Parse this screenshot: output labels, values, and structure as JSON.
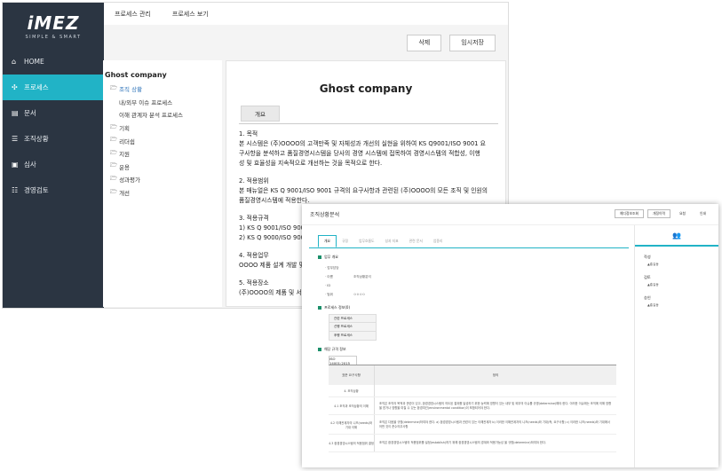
{
  "brand": {
    "logo": "iMEZ",
    "tagline": "SIMPLE & SMART"
  },
  "sidebar": {
    "items": [
      {
        "icon": "home-icon",
        "glyph": "⌂",
        "label": "HOME"
      },
      {
        "icon": "gears-icon",
        "glyph": "✣",
        "label": "프로세스"
      },
      {
        "icon": "document-icon",
        "glyph": "▤",
        "label": "문서"
      },
      {
        "icon": "list-icon",
        "glyph": "☰",
        "label": "조직상황"
      },
      {
        "icon": "audit-icon",
        "glyph": "▣",
        "label": "심사"
      },
      {
        "icon": "review-icon",
        "glyph": "☷",
        "label": "경영검토"
      }
    ]
  },
  "topbar": {
    "tabs": [
      "프로세스 관리",
      "프로세스 보기"
    ]
  },
  "toolbar": {
    "delete_label": "삭제",
    "save_temp_label": "임시저장"
  },
  "tree": {
    "root": "Ghost company",
    "items": [
      {
        "label": "조직 상황",
        "folder": true
      },
      {
        "label": "내/외부 이슈 프로세스",
        "folder": false
      },
      {
        "label": "이해 관계자 분석 프로세스",
        "folder": false
      },
      {
        "label": "기획",
        "folder": true
      },
      {
        "label": "리더쉽",
        "folder": true
      },
      {
        "label": "지원",
        "folder": true
      },
      {
        "label": "운용",
        "folder": true
      },
      {
        "label": "성과평가",
        "folder": true
      },
      {
        "label": "개선",
        "folder": true
      }
    ]
  },
  "document": {
    "title": "Ghost company",
    "tab": "개요",
    "sections": [
      {
        "heading": "1. 목적",
        "lines": [
          "본 시스템은 (주)OOOO의 고객만족 및 자체성과 개선의 실현을 위하여 KS Q9001/ISO 9001 요",
          "구사항을 분석하고 품질경영시스템을 당사의 경영 시스템에 접목하여 경영시스템의 적합성, 이행",
          "성 및 효율성을 지속적으로 개선하는 것을 목적으로 한다."
        ]
      },
      {
        "heading": "2. 적용범위",
        "lines": [
          "본 매뉴얼은 KS Q 9001/ISO 9001 규격의 요구사항과 관련된 (주)OOOO의 모든 조직 및 인원의",
          "품질경영시스템에 적용한다."
        ]
      },
      {
        "heading": "3. 적용규격",
        "lines": [
          "1) KS Q 9001/ISO 9000",
          "2) KS Q 9000/ISO 9000"
        ]
      },
      {
        "heading": "4. 적용업무",
        "lines": [
          "OOOO 제품 설계 개발 및"
        ]
      },
      {
        "heading": "5. 적용장소",
        "lines": [
          "(주)OOOO의 제품 및 서"
        ]
      }
    ]
  },
  "overlay": {
    "title": "조직상황분석",
    "buttons": [
      "예디정보조회",
      "개정이력",
      "요청",
      "인쇄"
    ],
    "tabs": [
      "개요",
      "규정",
      "업무흐름도",
      "성과 지표",
      "관련 문서",
      "업종리"
    ],
    "info_head": "업무 개요",
    "info_rows": [
      {
        "k": "· 업무담당",
        "v": ""
      },
      {
        "k": "· 이름",
        "v": "조직상황분석"
      },
      {
        "k": "· ID",
        "v": ""
      },
      {
        "k": "· 범위",
        "v": "ㅇㅇㅇㅇ"
      }
    ],
    "proc_head": "프로세스 정보(0)",
    "procs": [
      "관련 프로세스",
      "선행 프로세스",
      "후행 프로세스"
    ],
    "std_head": "해당 규격 정보",
    "std_tab": "ISO 14001:2015",
    "std_cols": [
      "표준 요구사항",
      "정의"
    ],
    "std_rows": [
      {
        "c1": "4. 조직상황",
        "c2": ""
      },
      {
        "c1": "4.1 조직과 조직상황의 이해",
        "c2": "조직은 조직의 목적과 관련이 있고, 환경경영시스템의 의도된 결과를 달성하기 위한 능력에 영향이 있는 내부 및 외부의 이슈를 규명(determine)해야 한다. 이러한 이슈에는 조직에 의해 영향을 받거나 영향을 미칠 수 있는 환경여건(environmental condition)이 포함되어야 한다."
      },
      {
        "c1": "4.2 이해관계자의 니즈(needs)와 기대 이해",
        "c2": "조직은 다음을 규명(determine)하여야 한다. a) 환경경영시스템과 관련이 있는 이해관계자 b) 이러한 이해관계자의 니즈(needs)와 기대(즉, 요구사항) c) 이러한 니즈(needs)와 기대에서 어떤 것이 준수의무사항"
      },
      {
        "c1": "4.3 환경경영시스템의 적용범위 결정",
        "c2": "조직은 환경경영시스템의 적용범위를 설정(establish)하기 위해 환경경영시스템의 경계와 적용가능성 을 규명(determine)하여야 한다."
      }
    ],
    "approvals": [
      {
        "k": "작성",
        "v": "홍길동"
      },
      {
        "k": "검토",
        "v": "홍길동"
      },
      {
        "k": "승인",
        "v": "홍길동"
      }
    ]
  }
}
